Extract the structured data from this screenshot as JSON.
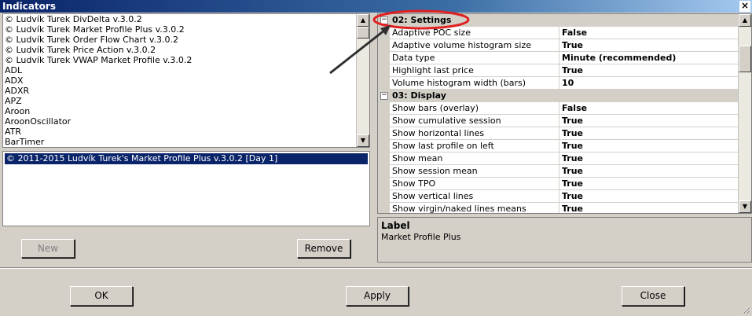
{
  "window": {
    "title": "Indicators",
    "close_label": "×"
  },
  "indicator_list": {
    "items": [
      "© Ludvík Turek DivDelta v.3.0.2",
      "© Ludvík Turek Market Profile Plus v.3.0.2",
      "© Ludvík Turek Order Flow Chart v.3.0.2",
      "© Ludvík Turek Price Action v.3.0.2",
      "© Ludvík Turek VWAP Market Profile v.3.0.2",
      "ADL",
      "ADX",
      "ADXR",
      "APZ",
      "Aroon",
      "AroonOscillator",
      "ATR",
      "BarTimer"
    ]
  },
  "applied_list": {
    "selected": "© 2011-2015 Ludvík Turek's Market Profile Plus v.3.0.2 [Day 1]"
  },
  "buttons": {
    "new": "New",
    "remove": "Remove",
    "ok": "OK",
    "apply": "Apply",
    "close": "Close"
  },
  "properties": {
    "sections": [
      {
        "title": "02: Settings",
        "collapse_glyph": "−",
        "rows": [
          {
            "name": "Adaptive POC size",
            "value": "False"
          },
          {
            "name": "Adaptive volume histogram size",
            "value": "True"
          },
          {
            "name": "Data type",
            "value": "Minute (recommended)"
          },
          {
            "name": "Highlight last price",
            "value": "True"
          },
          {
            "name": "Volume histogram width (bars)",
            "value": "10"
          }
        ]
      },
      {
        "title": "03: Display",
        "collapse_glyph": "−",
        "rows": [
          {
            "name": "Show bars (overlay)",
            "value": "False"
          },
          {
            "name": "Show cumulative session",
            "value": "True"
          },
          {
            "name": "Show horizontal lines",
            "value": "True"
          },
          {
            "name": "Show last profile on left",
            "value": "True"
          },
          {
            "name": "Show mean",
            "value": "True"
          },
          {
            "name": "Show session mean",
            "value": "True"
          },
          {
            "name": "Show TPO",
            "value": "True"
          },
          {
            "name": "Show vertical lines",
            "value": "True"
          },
          {
            "name": "Show virgin/naked lines means",
            "value": "True"
          }
        ]
      }
    ]
  },
  "description": {
    "title": "Label",
    "text": "Market Profile Plus"
  },
  "annotation": {
    "highlight_color": "#e02020",
    "arrow_color": "#303030"
  },
  "icons": {
    "scroll_up": "▲",
    "scroll_down": "▼"
  }
}
